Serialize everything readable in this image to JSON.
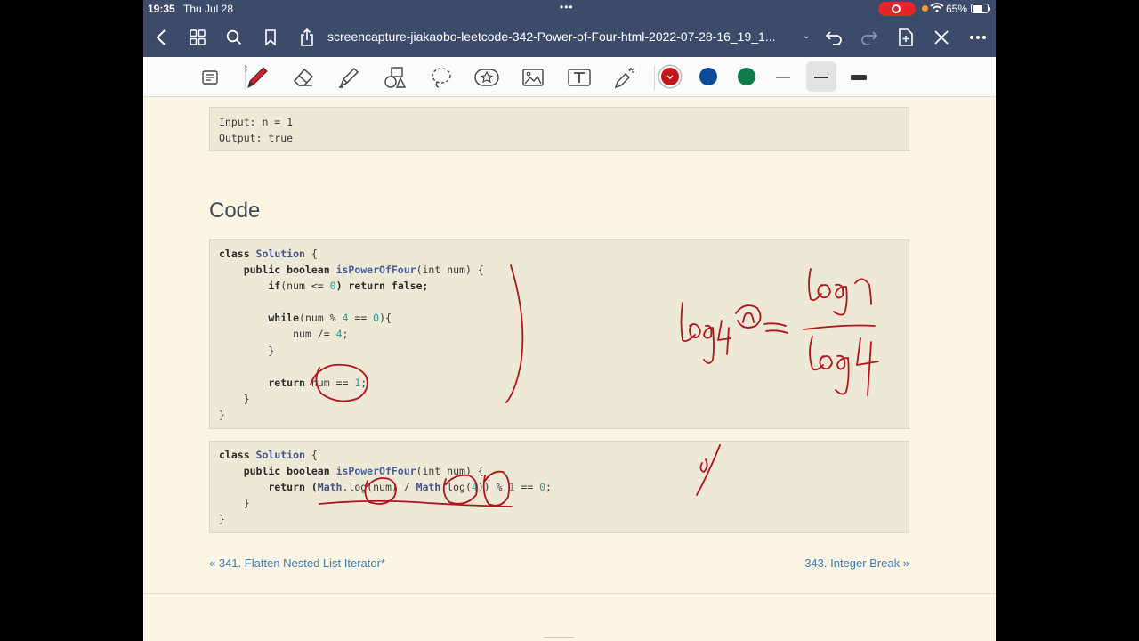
{
  "status": {
    "time": "19:35",
    "date": "Thu Jul 28",
    "dots": "•••",
    "battery_pct": "65%"
  },
  "navbar": {
    "title": "screencapture-jiakaobo-leetcode-342-Power-of-Four-html-2022-07-28-16_19_1..."
  },
  "toolbar": {
    "colors": [
      "#c4161c",
      "#0c4a9a",
      "#0f7b4a"
    ],
    "selected_color": "#c4161c"
  },
  "example": {
    "lines": [
      "Input: n = 1",
      "Output: true"
    ]
  },
  "heading": "Code",
  "code1": {
    "l1": {
      "a": "class ",
      "b": "Solution",
      "c": " {"
    },
    "l2": {
      "a": "    public boolean ",
      "b": "isPowerOfFour",
      "c": "(int num) {"
    },
    "l3": {
      "a": "        if",
      "b": "(num <= ",
      "c": "0",
      "d": ") return false;"
    },
    "l5": {
      "a": "        while",
      "b": "(num % ",
      "c": "4",
      "d": " == ",
      "e": "0",
      "f": "){"
    },
    "l6": {
      "a": "            num /= ",
      "b": "4",
      "c": ";"
    },
    "l7": "        }",
    "l9": {
      "a": "        return ",
      "b": "num == ",
      "c": "1",
      "d": ";"
    },
    "l10": "    }",
    "l11": "}"
  },
  "code2": {
    "l1": {
      "a": "class ",
      "b": "Solution",
      "c": " {"
    },
    "l2": {
      "a": "    public boolean ",
      "b": "isPowerOfFour",
      "c": "(int num) {"
    },
    "l3": {
      "a": "        return (",
      "b": "Math",
      "c": ".log(num) / ",
      "d": "Math",
      "e": ".log(",
      "f": "4",
      "g": ")) % ",
      "h": "1",
      "i": " == ",
      "j": "0",
      "k": ";"
    },
    "l4": "    }",
    "l5": "}"
  },
  "nav": {
    "prev": "« 341. Flatten Nested List Iterator*",
    "next": "343. Integer Break »"
  }
}
